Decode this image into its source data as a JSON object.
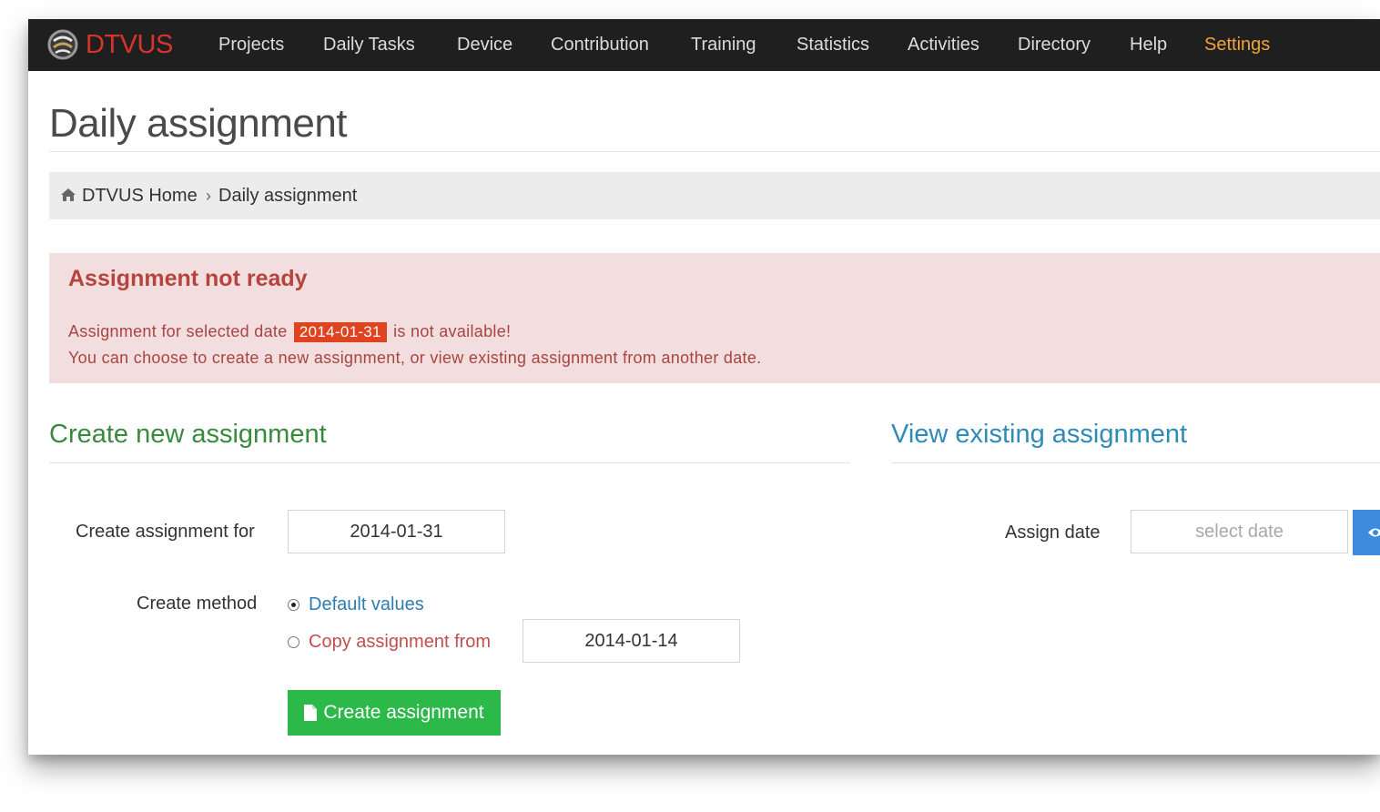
{
  "navbar": {
    "brand": "DTVUS",
    "items": [
      {
        "label": "Projects"
      },
      {
        "label": "Daily Tasks"
      },
      {
        "label": "Device"
      },
      {
        "label": "Contribution"
      },
      {
        "label": "Training"
      },
      {
        "label": "Statistics"
      },
      {
        "label": "Activities"
      },
      {
        "label": "Directory"
      },
      {
        "label": "Help"
      },
      {
        "label": "Settings",
        "active": true
      }
    ]
  },
  "page": {
    "title": "Daily assignment"
  },
  "breadcrumb": {
    "home": "DTVUS Home",
    "separator": "›",
    "current": "Daily assignment"
  },
  "alert": {
    "title": "Assignment not ready",
    "line1_prefix": "Assignment for selected date",
    "date": "2014-01-31",
    "line1_suffix": "is not available!",
    "line2": "You can choose to create a new assignment, or view existing assignment from another date."
  },
  "create": {
    "section_title": "Create new assignment",
    "for_label": "Create assignment for",
    "for_value": "2014-01-31",
    "method_label": "Create method",
    "option_default": "Default values",
    "option_copy": "Copy assignment from",
    "copy_value": "2014-01-14",
    "selected_method": "default",
    "button_label": "Create assignment"
  },
  "view": {
    "section_title": "View existing assignment",
    "date_label": "Assign date",
    "date_placeholder": "select date"
  },
  "colors": {
    "navbar_bg": "#1f1f1f",
    "brand": "#d9342b",
    "nav_active": "#f0a33a",
    "alert_bg": "#f2dede",
    "badge": "#e0431f",
    "create_button": "#2db84a",
    "view_button": "#3d8bdd"
  },
  "icons": [
    "brand-logo-icon",
    "home-icon",
    "file-icon",
    "eye-icon"
  ]
}
